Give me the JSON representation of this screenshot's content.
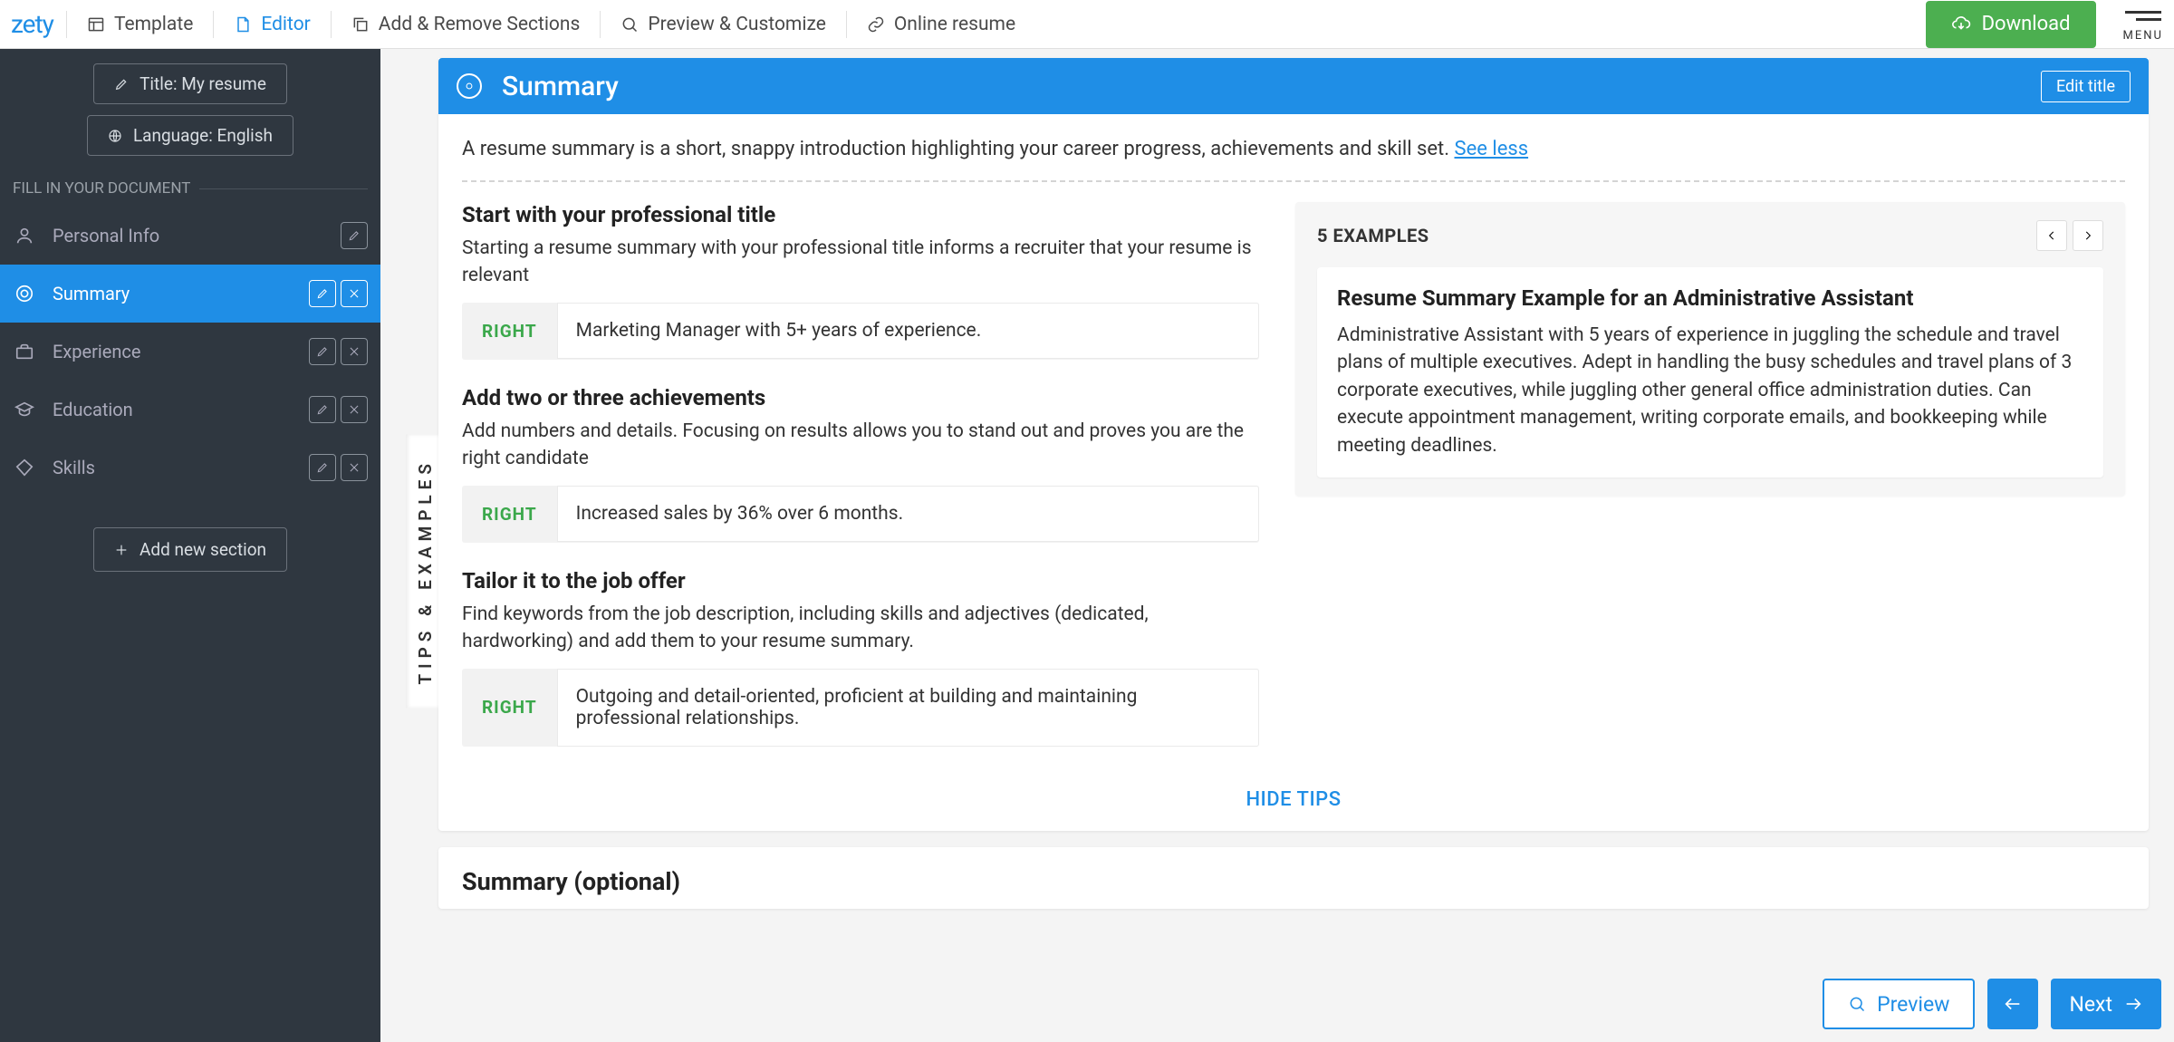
{
  "topbar": {
    "logo": "zety",
    "items": [
      {
        "label": "Template"
      },
      {
        "label": "Editor"
      },
      {
        "label": "Add & Remove Sections"
      },
      {
        "label": "Preview & Customize"
      },
      {
        "label": "Online resume"
      }
    ],
    "download": "Download",
    "menu": "MENU"
  },
  "sidebar": {
    "title_btn": "Title: My resume",
    "lang_btn": "Language: English",
    "section_label": "FILL IN YOUR DOCUMENT",
    "items": [
      {
        "label": "Personal Info"
      },
      {
        "label": "Summary"
      },
      {
        "label": "Experience"
      },
      {
        "label": "Education"
      },
      {
        "label": "Skills"
      }
    ],
    "add_section": "Add new section"
  },
  "vertical_tab": "TIPS & EXAMPLES",
  "panel": {
    "title": "Summary",
    "edit_title": "Edit title",
    "intro_text": "A resume summary is a short, snappy introduction highlighting your career progress, achievements and skill set. ",
    "see_less": "See less",
    "tips": [
      {
        "heading": "Start with your professional title",
        "desc": "Starting a resume summary with your professional title informs a recruiter that your resume is relevant",
        "right_label": "RIGHT",
        "right_text": "Marketing Manager with 5+ years of experience."
      },
      {
        "heading": "Add two or three achievements",
        "desc": "Add numbers and details. Focusing on results allows you to stand out and proves you are the right candidate",
        "right_label": "RIGHT",
        "right_text": "Increased sales by 36% over 6 months."
      },
      {
        "heading": "Tailor it to the job offer",
        "desc": "Find keywords from the job description, including skills and adjectives (dedicated, hardworking) and add them to your resume summary.",
        "right_label": "RIGHT",
        "right_text": "Outgoing and detail-oriented, proficient at building and maintaining professional relationships."
      }
    ],
    "examples": {
      "count_label": "5 EXAMPLES",
      "title": "Resume Summary Example for an Administrative Assistant",
      "body": "Administrative Assistant with 5 years of experience in juggling the schedule and travel plans of multiple executives. Adept in handling the busy schedules and travel plans of 3 corporate executives, while juggling other general office administration duties. Can execute appointment management, writing corporate emails, and bookkeeping while meeting deadlines."
    },
    "hide_tips": "HIDE TIPS"
  },
  "section2_title": "Summary (optional)",
  "footer": {
    "preview": "Preview",
    "next": "Next"
  }
}
